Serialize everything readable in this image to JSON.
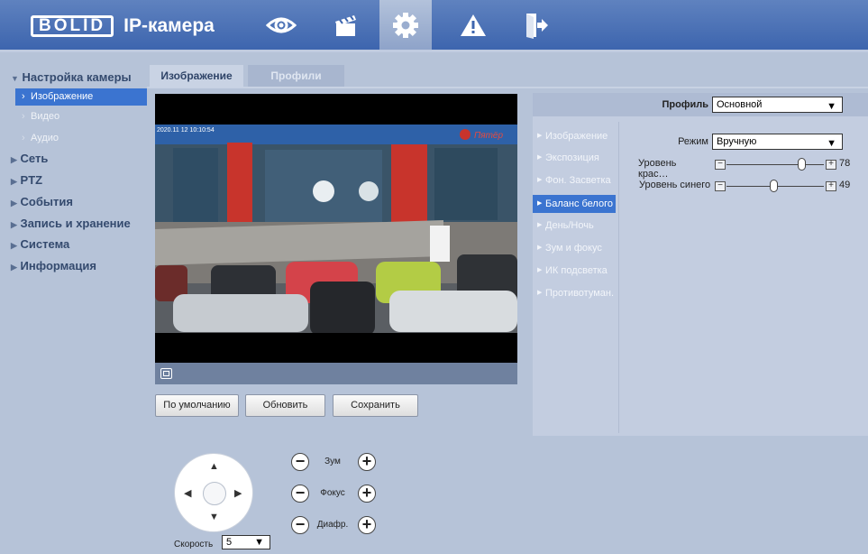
{
  "header": {
    "logo_text": "BOLID",
    "title": "IP-камера",
    "nav": [
      {
        "name": "live-view",
        "icon": "eye-icon"
      },
      {
        "name": "playback",
        "icon": "clapperboard-icon"
      },
      {
        "name": "settings",
        "icon": "gear-icon",
        "active": true
      },
      {
        "name": "alarm",
        "icon": "warning-icon"
      },
      {
        "name": "logout",
        "icon": "exit-icon"
      }
    ]
  },
  "sidebar": {
    "camera_settings": "Настройка камеры",
    "sub_items": [
      "Изображение",
      "Видео",
      "Аудио"
    ],
    "groups": [
      "Сеть",
      "PTZ",
      "События",
      "Запись и хранение",
      "Система",
      "Информация"
    ]
  },
  "tabs": [
    "Изображение",
    "Профили"
  ],
  "video": {
    "timestamp": "2020.11 12 10:10:54",
    "sign_text": "Пятёр"
  },
  "buttons": {
    "default": "По умолчанию",
    "refresh": "Обновить",
    "save": "Сохранить"
  },
  "ptz": {
    "zoom": "Зум",
    "focus": "Фокус",
    "iris": "Диафр.",
    "speed_label": "Скорость",
    "speed_value": "5"
  },
  "profile": {
    "label": "Профиль",
    "value": "Основной"
  },
  "menu": [
    "Изображение",
    "Экспозиция",
    "Фон. Засветка",
    "Баланс белого",
    "День/Ночь",
    "Зум и фокус",
    "ИК подсветка",
    "Противотуман."
  ],
  "white_balance": {
    "mode_label": "Режим",
    "mode_value": "Вручную",
    "red_label": "Уровень крас…",
    "red_value": "78",
    "blue_label": "Уровень синего",
    "blue_value": "49"
  },
  "colors": {
    "header": "#3d65ae",
    "accent": "#3b74d0",
    "panel": "#c3cde0"
  }
}
